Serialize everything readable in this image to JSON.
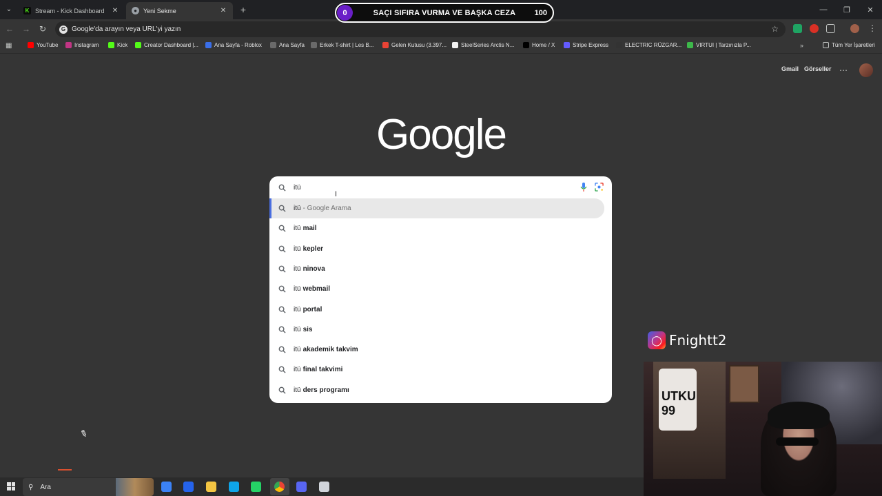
{
  "browser": {
    "tabs": [
      {
        "title": "Stream - Kick Dashboard",
        "favicon": "kick-icon",
        "active": false
      },
      {
        "title": "Yeni Sekme",
        "favicon": "chrome-icon",
        "active": true
      }
    ],
    "omnibox_placeholder": "Google'da arayın veya URL'yi yazın",
    "bookmarks": [
      {
        "label": "YouTube",
        "icon": "youtube-icon",
        "color": "#ff0000"
      },
      {
        "label": "Instagram",
        "icon": "instagram-icon",
        "color": "#c13584"
      },
      {
        "label": "Kick",
        "icon": "kick-icon",
        "color": "#53fc18"
      },
      {
        "label": "Creator Dashboard |...",
        "icon": "kick-icon",
        "color": "#53fc18"
      },
      {
        "label": "Ana Sayfa - Roblox",
        "icon": "roblox-icon",
        "color": "#3a6ee8"
      },
      {
        "label": "Ana Sayfa",
        "icon": "globe-icon",
        "color": "#6a6a6a"
      },
      {
        "label": "Erkek T-shirt | Les B...",
        "icon": "globe-icon",
        "color": "#6a6a6a"
      },
      {
        "label": "Gelen Kutusu (3.397...",
        "icon": "gmail-icon",
        "color": "#ea4335"
      },
      {
        "label": "SteelSeries Arctis N...",
        "icon": "steelseries-icon",
        "color": "#f2f2f2"
      },
      {
        "label": "Home / X",
        "icon": "x-icon",
        "color": "#000000"
      },
      {
        "label": "Stripe Express",
        "icon": "stripe-icon",
        "color": "#635bff"
      },
      {
        "label": "ELECTRIC RÜZGAR...",
        "icon": "globe-icon",
        "color": "#333333"
      },
      {
        "label": "VIRTUI | Tarzınızla P...",
        "icon": "virtui-icon",
        "color": "#3db84a"
      }
    ],
    "all_bookmarks_label": "Tüm Yer İşaretleri"
  },
  "overlay": {
    "current": "0",
    "label": "SAÇI SIFIRA VURMA VE BAŞKA CEZA",
    "goal": "100",
    "progress": 0,
    "accent_color": "#6a1fc8"
  },
  "google": {
    "logo": "Google",
    "links": [
      "Gmail",
      "Görseller"
    ],
    "search_value": "itü",
    "suggestions": [
      {
        "query": "itü",
        "rest": "",
        "hint": "- Google Arama",
        "highlighted": true
      },
      {
        "query": "itü",
        "rest": "mail"
      },
      {
        "query": "itü",
        "rest": "kepler"
      },
      {
        "query": "itü",
        "rest": "ninova"
      },
      {
        "query": "itü",
        "rest": "webmail"
      },
      {
        "query": "itü",
        "rest": "portal"
      },
      {
        "query": "itü",
        "rest": "sis"
      },
      {
        "query": "itü",
        "rest": "akademik takvim"
      },
      {
        "query": "itü",
        "rest": "final takvimi"
      },
      {
        "query": "itü",
        "rest": "ders programı"
      }
    ]
  },
  "stream": {
    "instagram_handle": "Fnightt2",
    "jersey_text": "UTKU 99"
  },
  "taskbar": {
    "search_placeholder": "Ara",
    "apps": [
      "copilot-icon",
      "store-icon",
      "explorer-icon",
      "edge-icon",
      "whatsapp-icon",
      "chrome-icon",
      "discord-icon",
      "obs-icon"
    ]
  }
}
